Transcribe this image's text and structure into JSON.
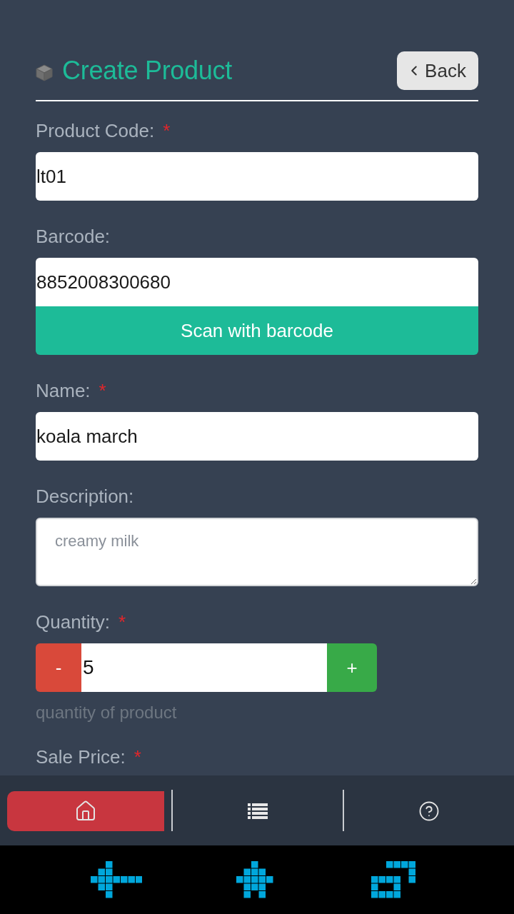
{
  "header": {
    "title": "Create Product",
    "back_button": "Back"
  },
  "fields": [
    {
      "kind": "text",
      "label": "Product Code:",
      "required_mark": "*",
      "value": "lt01"
    },
    {
      "kind": "scan",
      "label": "Barcode:",
      "value": "8852008300680",
      "button": "Scan with barcode"
    },
    {
      "kind": "text",
      "label": "Name:",
      "required_mark": "*",
      "value": "koala march"
    },
    {
      "kind": "textarea",
      "label": "Description:",
      "placeholder": "creamy milk"
    },
    {
      "kind": "stepper",
      "label": "Quantity:",
      "required_mark": "*",
      "value": "5",
      "decrement": "-",
      "increment": "+",
      "help": "quantity of product"
    },
    {
      "kind": "label",
      "label": "Sale Price:",
      "required_mark": "*"
    }
  ],
  "nav_tabs": [
    {
      "kind": "home",
      "selected": true
    },
    {
      "kind": "list",
      "selected": false
    },
    {
      "kind": "help",
      "selected": false
    }
  ],
  "system_nav": [
    {
      "kind": "back"
    },
    {
      "kind": "home"
    },
    {
      "kind": "recents"
    }
  ]
}
